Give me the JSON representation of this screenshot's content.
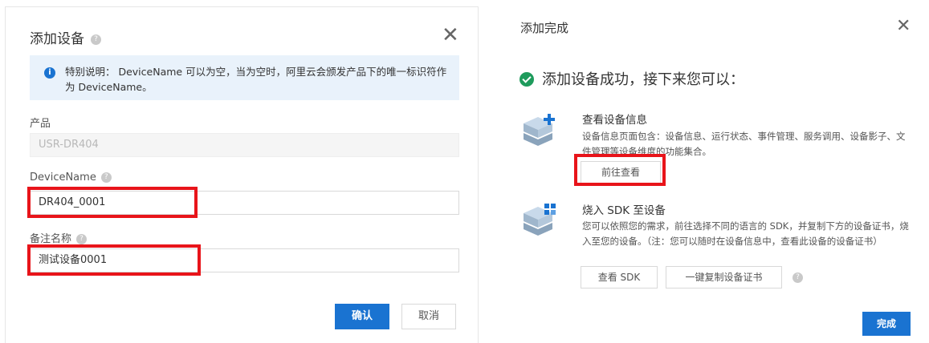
{
  "left_dialog": {
    "title": "添加设备",
    "notice": "特别说明： DeviceName 可以为空，当为空时，阿里云会颁发产品下的唯一标识符作为 DeviceName。",
    "product_label": "产品",
    "product_value": "USR-DR404",
    "device_name_label": "DeviceName",
    "device_name_value": "DR404_0001",
    "remark_label": "备注名称",
    "remark_value": "测试设备0001",
    "confirm_label": "确认",
    "cancel_label": "取消"
  },
  "right_dialog": {
    "title": "添加完成",
    "success_text": "添加设备成功，接下来您可以：",
    "view_info": {
      "title": "查看设备信息",
      "desc": "设备信息页面包含：设备信息、运行状态、事件管理、服务调用、设备影子、文件管理等设备维度的功能集合。",
      "button": "前往查看"
    },
    "burn_sdk": {
      "title": "烧入 SDK 至设备",
      "desc": "您可以依照您的需求，前往选择不同的语言的 SDK，并复制下方的设备证书，烧入至您的设备。（注：您可以随时在设备信息中，查看此设备的设备证书）",
      "view_sdk_button": "查看 SDK",
      "copy_cert_button": "一键复制设备证书"
    },
    "done_label": "完成"
  },
  "colors": {
    "primary": "#1a73d1",
    "highlight_red": "#e8141a",
    "success_green": "#1e9b5c",
    "notice_bg": "#e9f2fb"
  }
}
